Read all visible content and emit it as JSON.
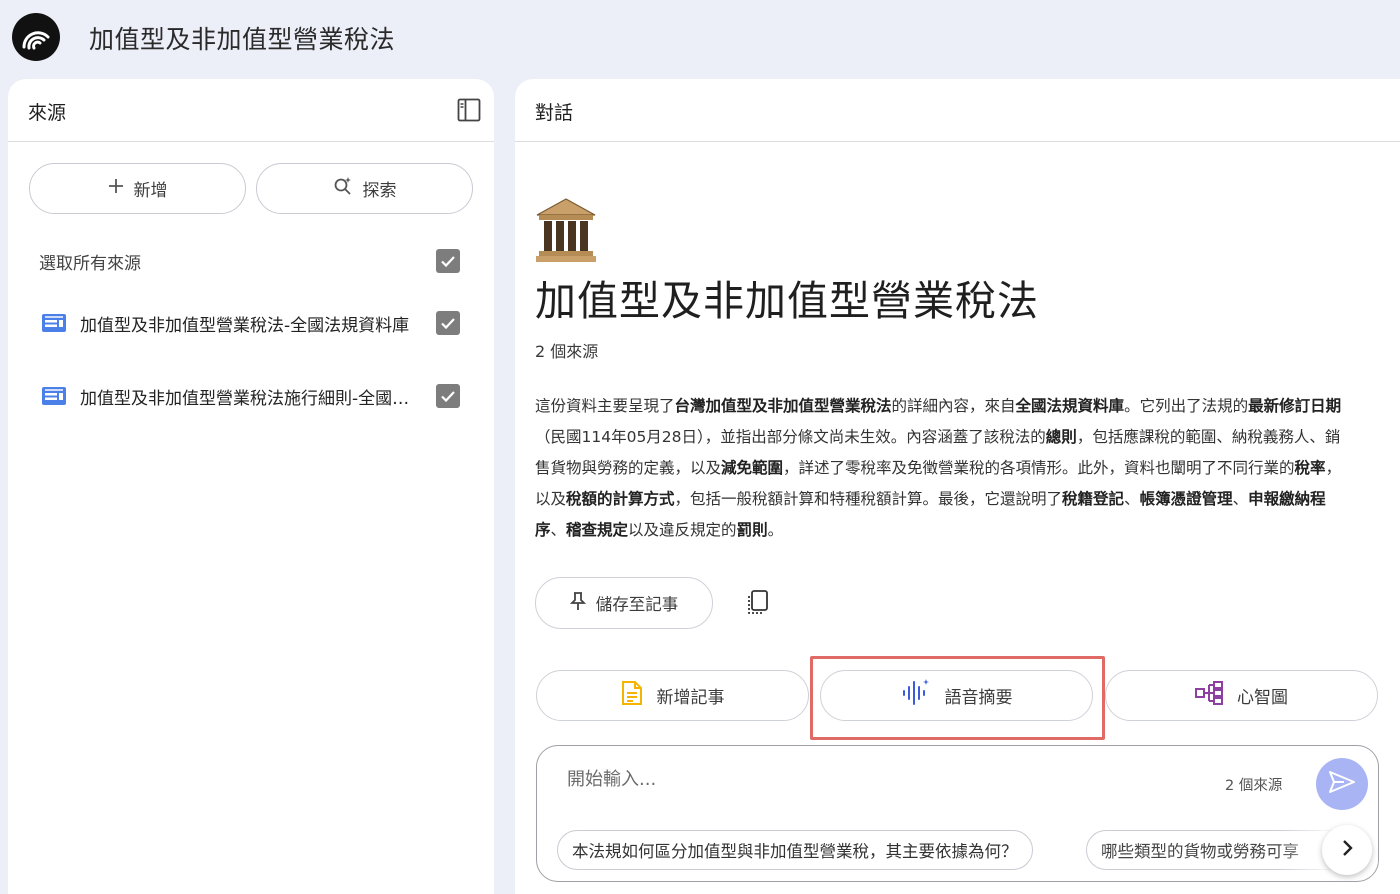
{
  "app": {
    "title": "加值型及非加值型營業稅法",
    "logo_icon": "podcast-waves-icon"
  },
  "sources_panel": {
    "title": "來源",
    "toggle_icon": "sidebar-toggle-icon",
    "add_button": {
      "label": "新增",
      "icon": "plus-icon"
    },
    "explore_button": {
      "label": "探索",
      "icon": "search-sparkle-icon"
    },
    "select_all_label": "選取所有來源",
    "select_all_checked": true,
    "items": [
      {
        "label": "加值型及非加值型營業稅法-全國法規資料庫",
        "icon": "web-page-icon",
        "checked": true
      },
      {
        "label": "加值型及非加值型營業稅法施行細則-全國法規資料庫",
        "icon": "web-page-icon",
        "checked": true
      }
    ]
  },
  "chat_panel": {
    "title": "對話",
    "emoji_icon": "classical-building-icon",
    "notebook_title": "加值型及非加值型營業稅法",
    "source_count": "2 個來源",
    "summary": {
      "s1": "這份資料主要呈現了",
      "b1": "台灣加值型及非加值型營業稅法",
      "s2": "的詳細內容，來自",
      "b2": "全國法規資料庫",
      "s3": "。它列出了法規的",
      "b3": "最新修訂日期",
      "s4": "（民國114年05月28日），並指出部分條文尚未生效。內容涵蓋了該稅法的",
      "b4": "總則",
      "s5": "，包括應課稅的範圍、納稅義務人、銷售貨物與勞務的定義，以及",
      "b5": "減免範圍",
      "s6": "，詳述了零稅率及免徵營業稅的各項情形。此外，資料也闡明了不同行業的",
      "b6": "稅率",
      "s7": "，以及",
      "b7": "稅額的計算方式",
      "s8": "，包括一般稅額計算和特種稅額計算。最後，它還說明了",
      "b8": "稅籍登記",
      "s9": "、",
      "b9": "帳簿憑證管理",
      "s10": "、",
      "b10": "申報繳納程序",
      "s11": "、",
      "b11": "稽查規定",
      "s12": "以及違反規定的",
      "b12": "罰則",
      "s13": "。"
    },
    "save_note_button": {
      "label": "儲存至記事",
      "icon": "pin-icon"
    },
    "copy_icon": "copy-icon",
    "actions": [
      {
        "label": "新增記事",
        "icon": "document-icon",
        "color": "#f4b400"
      },
      {
        "label": "語音摘要",
        "icon": "audio-waveform-icon",
        "color": "#3b5bdb"
      },
      {
        "label": "心智圖",
        "icon": "mind-map-icon",
        "color": "#8e3fa0"
      }
    ],
    "highlight_color": "#e06a66",
    "composer": {
      "placeholder": "開始輸入...",
      "source_count": "2 個來源",
      "send_icon": "send-icon",
      "send_color": "#a9b4f5",
      "suggestions": [
        "本法規如何區分加值型與非加值型營業稅，其主要依據為何？",
        "哪些類型的貨物或勞務可享"
      ],
      "next_icon": "chevron-right-icon"
    }
  }
}
